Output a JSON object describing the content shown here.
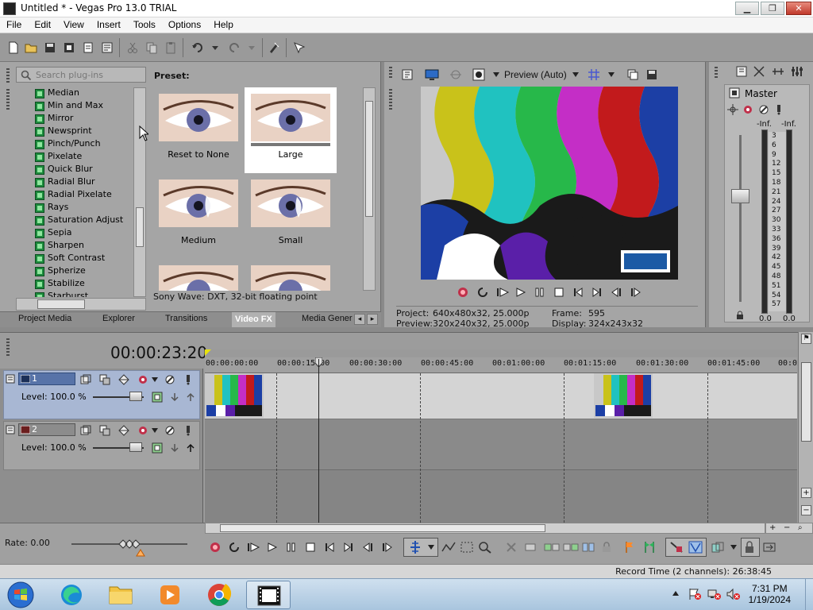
{
  "window": {
    "title": "Untitled * - Vegas Pro 13.0 TRIAL",
    "minimize_label": "▁",
    "maximize_label": "❐",
    "close_label": "✕"
  },
  "menu": [
    "File",
    "Edit",
    "View",
    "Insert",
    "Tools",
    "Options",
    "Help"
  ],
  "plugin_chooser": {
    "search_placeholder": "Search plug-ins",
    "items": [
      "Median",
      "Min and Max",
      "Mirror",
      "Newsprint",
      "Pinch/Punch",
      "Pixelate",
      "Quick Blur",
      "Radial Blur",
      "Radial Pixelate",
      "Rays",
      "Saturation Adjust",
      "Sepia",
      "Sharpen",
      "Soft Contrast",
      "Spherize",
      "Stabilize",
      "Starburst"
    ],
    "preset_heading": "Preset:",
    "presets": [
      {
        "label": "Reset to None",
        "selected": false
      },
      {
        "label": "Large",
        "selected": true
      },
      {
        "label": "Medium",
        "selected": false
      },
      {
        "label": "Small",
        "selected": false
      },
      {
        "label": "",
        "selected": false
      },
      {
        "label": "",
        "selected": false
      }
    ],
    "status": "Sony Wave: DXT, 32-bit floating point"
  },
  "tabs": [
    "Project Media",
    "Explorer",
    "Transitions",
    "Video FX",
    "Media Gener"
  ],
  "active_tab": "Video FX",
  "preview": {
    "quality_label": "Preview (Auto)",
    "project_label": "Project:",
    "project_value": "640x480x32, 25.000p",
    "preview_label": "Preview:",
    "preview_value": "320x240x32, 25.000p",
    "frame_label": "Frame:",
    "frame_value": "595",
    "display_label": "Display:",
    "display_value": "324x243x32",
    "colors": [
      "#c8c8c8",
      "#c9c21a",
      "#20c2c0",
      "#27b84a",
      "#c42ec6",
      "#c21a1c",
      "#1c3fa5",
      "#ffffff",
      "#5a1fa8",
      "#1a1a1a"
    ]
  },
  "mixer": {
    "master_label": "Master",
    "left_peak": "-Inf.",
    "right_peak": "-Inf.",
    "scale": [
      "3",
      "6",
      "9",
      "12",
      "15",
      "18",
      "21",
      "24",
      "27",
      "30",
      "33",
      "36",
      "39",
      "42",
      "45",
      "48",
      "51",
      "54",
      "57"
    ],
    "left_value": "0.0",
    "right_value": "0.0"
  },
  "timeline": {
    "timecode": "00:00:23:20",
    "ruler": [
      "00:00:00:00",
      "00:00:15:00",
      "00:00:30:00",
      "00:00:45:00",
      "00:01:00:00",
      "00:01:15:00",
      "00:01:30:00",
      "00:01:45:00",
      "00:02"
    ],
    "tracks": [
      {
        "number": "1",
        "level": "Level: 100.0 %"
      },
      {
        "number": "2",
        "level": "Level: 100.0 %"
      }
    ],
    "rate": "Rate: 0.00"
  },
  "status": {
    "record_time": "Record Time (2 channels): 26:38:45"
  },
  "taskbar": {
    "time": "7:31 PM",
    "date": "1/19/2024"
  }
}
